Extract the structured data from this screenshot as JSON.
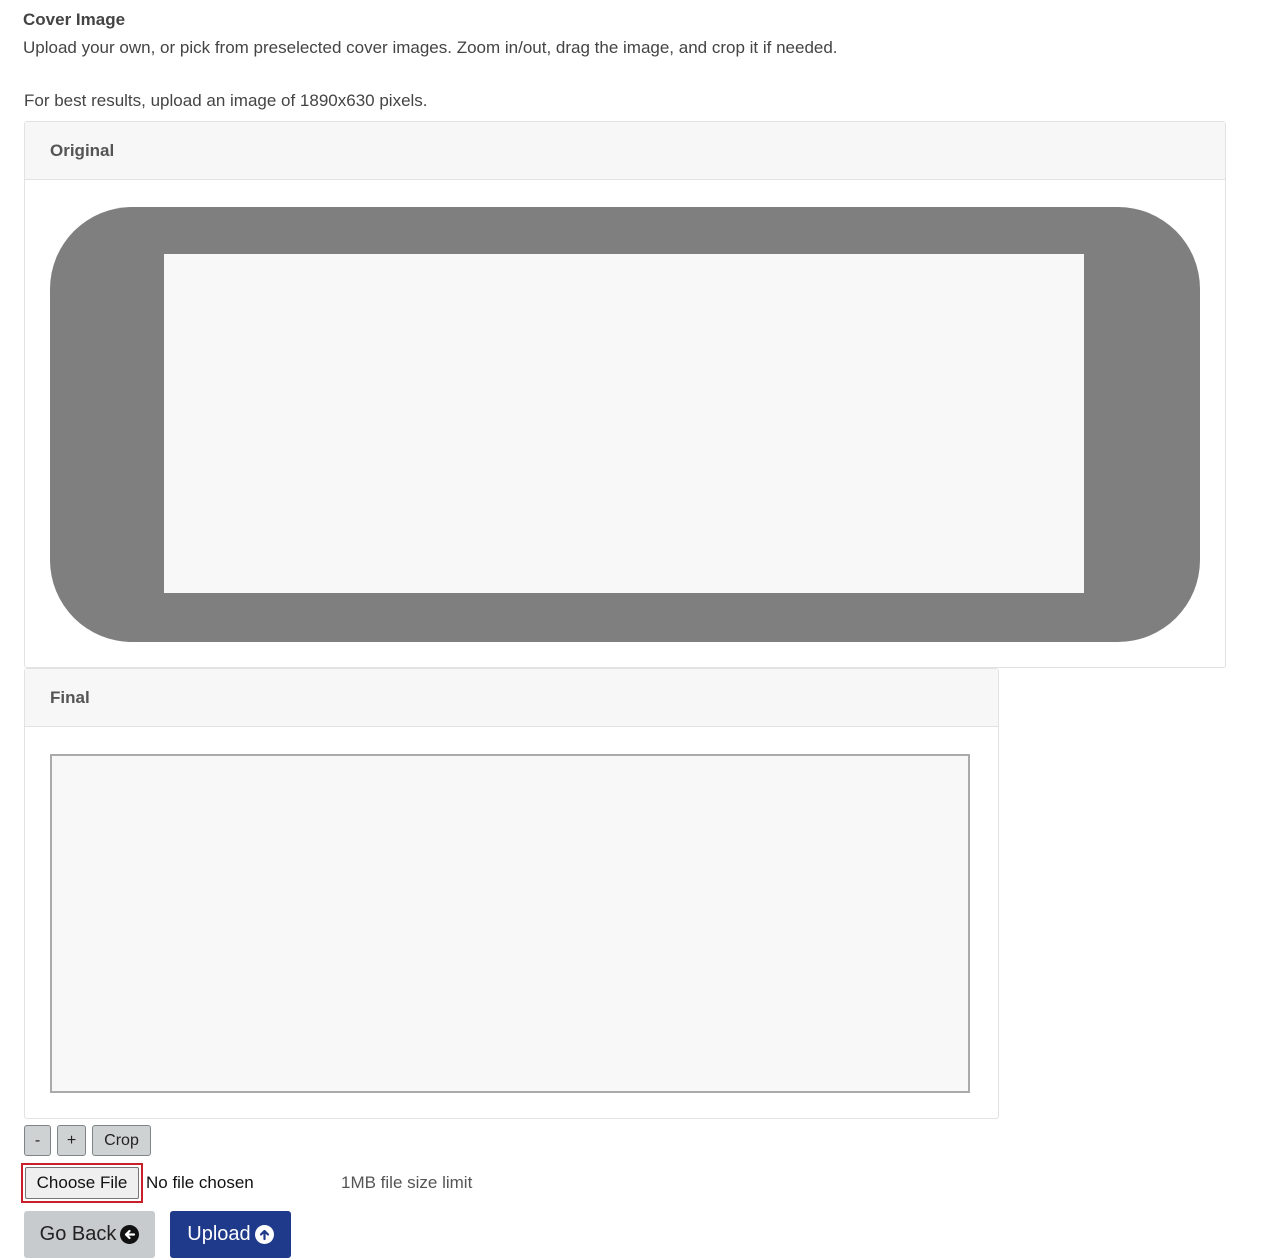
{
  "section": {
    "title": "Cover Image",
    "description": "Upload your own, or pick from preselected cover images. Zoom in/out, drag the image, and crop it if needed.",
    "hint": "For best results, upload an image of 1890x630 pixels."
  },
  "original_panel": {
    "title": "Original"
  },
  "final_panel": {
    "title": "Final"
  },
  "tools": {
    "zoom_out_label": "-",
    "zoom_in_label": "+",
    "crop_label": "Crop"
  },
  "file_input": {
    "button_label": "Choose File",
    "status": "No file chosen",
    "size_limit": "1MB file size limit"
  },
  "actions": {
    "go_back_label": "Go Back",
    "go_back_icon": "arrow-left-circle-icon",
    "upload_label": "Upload",
    "upload_icon": "arrow-up-circle-icon"
  },
  "colors": {
    "upload_button": "#1f3a8a",
    "file_highlight": "#c8202a"
  }
}
